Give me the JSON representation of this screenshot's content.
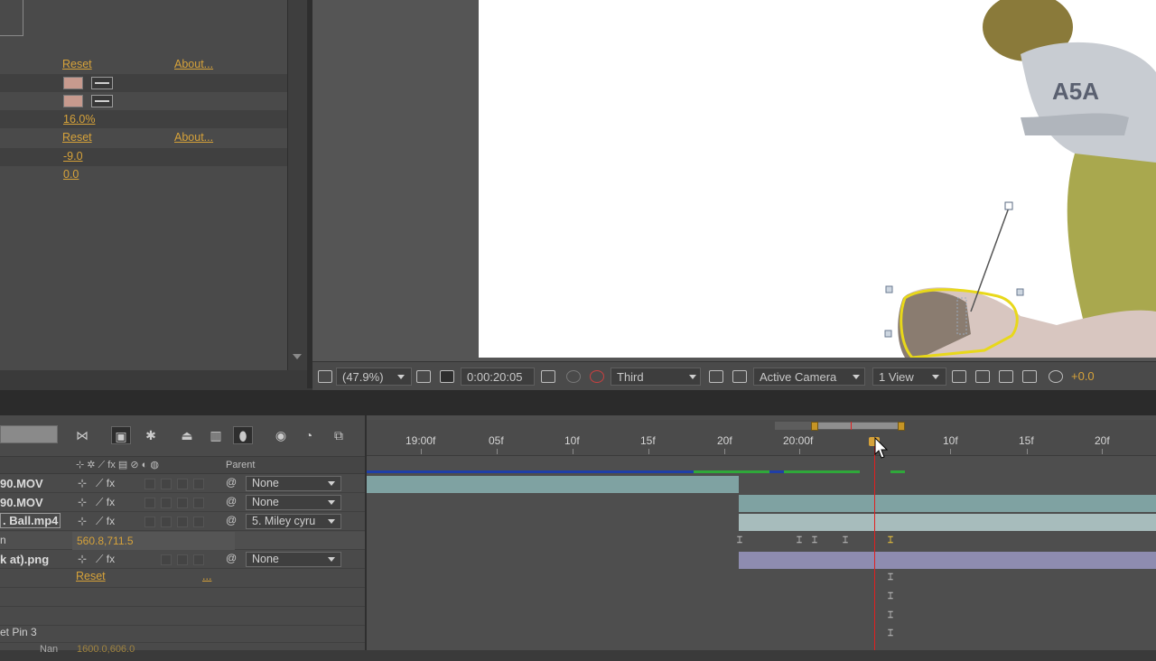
{
  "effect_controls": {
    "reset_label": "Reset",
    "about_label": "About...",
    "percent_value": "16.0%",
    "value_a": "-9.0",
    "value_b": "0.0",
    "swatch_color": "#c79a8e"
  },
  "viewer": {
    "zoom": "(47.9%)",
    "timecode": "0:00:20:05",
    "resolution": "Third",
    "camera": "Active Camera",
    "views": "1 View",
    "exposure": "+0.0"
  },
  "timeline": {
    "columns": {
      "parent": "Parent"
    },
    "ruler_ticks": [
      "19:00f",
      "05f",
      "10f",
      "15f",
      "20f",
      "20:00f",
      "",
      "10f",
      "15f",
      "20f"
    ],
    "layers": [
      {
        "name": "90.MOV",
        "parent": "None"
      },
      {
        "name": "90.MOV",
        "parent": "None"
      },
      {
        "name": ". Ball.mp4",
        "parent": "5. Miley cyru"
      },
      {
        "name": "k at).png",
        "parent": "None"
      }
    ],
    "property_row_name": "n",
    "property_value": "560.8,711.5",
    "reset_label": "Reset",
    "ellipsis": "...",
    "puppet_pin": "et Pin 3",
    "bottom_partial": "Nan",
    "bottom_value_partial": "1600.0,606.0"
  },
  "colors": {
    "accent": "#d6a23a",
    "playhead": "#e02020",
    "track_teal": "#7fa2a2",
    "track_lavender": "#8e8cb0"
  }
}
